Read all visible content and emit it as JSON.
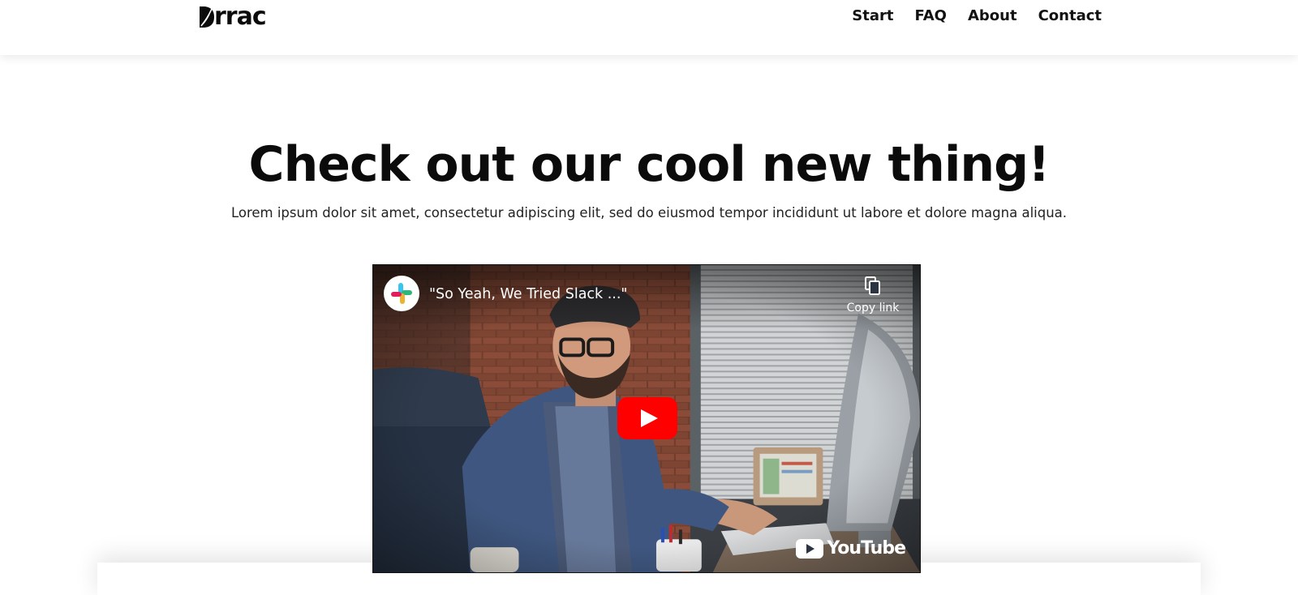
{
  "page": {
    "background": "#ffffff",
    "text_color": "#0b0b0b"
  },
  "nav": {
    "logo_text": "rrac",
    "logo_icon": "leaf-d-icon",
    "links": [
      {
        "label": "Start"
      },
      {
        "label": "FAQ"
      },
      {
        "label": "About"
      },
      {
        "label": "Contact"
      }
    ]
  },
  "hero": {
    "title": "Check out our cool new thing!",
    "subtitle": "Lorem ipsum dolor sit amet, consectetur adipiscing elit, sed do eiusmod tempor incididunt ut labore et dolore magna aliqua."
  },
  "video": {
    "title": "\"So Yeah, We Tried Slack ...\"",
    "channel_icon": "slack-logo-icon",
    "copy_link_label": "Copy link",
    "copy_icon": "copy-icon",
    "play_icon": "play-icon",
    "brand_label": "YouTube",
    "play_color": "#ff0000"
  }
}
